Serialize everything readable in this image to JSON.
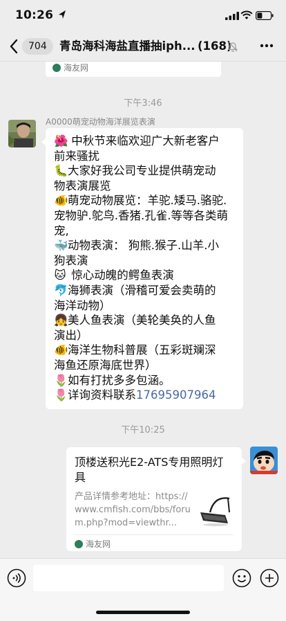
{
  "status": {
    "time": "10:26"
  },
  "header": {
    "badge": "704",
    "title": "青岛海科海盐直播抽iph...",
    "member_count": "(168)"
  },
  "chat": {
    "top_card_source": "海友网",
    "timestamp_1": "下午3:46",
    "sender_name": "A0000萌宠动物海洋展览表演",
    "message_lines": [
      {
        "emoji": "🌺",
        "text": " 中秋节来临欢迎广大新老客户"
      },
      {
        "emoji": "",
        "text": "前来骚扰"
      },
      {
        "emoji": "🐛",
        "text": "大家好我公司专业提供萌宠动"
      },
      {
        "emoji": "",
        "text": "物表演展览"
      },
      {
        "emoji": "🐠",
        "text": "萌宠动物展览：羊驼.矮马.骆驼."
      },
      {
        "emoji": "",
        "text": "宠物驴.鸵鸟.香猪.孔雀.等等各类萌"
      },
      {
        "emoji": "",
        "text": "宠,"
      },
      {
        "emoji": "🐳",
        "text": "动物表演：  狗熊.猴子.山羊.小"
      },
      {
        "emoji": "",
        "text": "狗表演"
      },
      {
        "emoji": "🐱",
        "text": " 惊心动魄的鳄鱼表演"
      },
      {
        "emoji": "🐬",
        "text": "海狮表演（滑稽可爱会卖萌的"
      },
      {
        "emoji": "",
        "text": "海洋动物）"
      },
      {
        "emoji": "👧",
        "text": "美人鱼表演（美轮美奂的人鱼"
      },
      {
        "emoji": "",
        "text": "演出）"
      },
      {
        "emoji": "🐠",
        "text": "海洋生物科普展（五彩斑斓深"
      },
      {
        "emoji": "",
        "text": "海鱼还原海底世界）"
      },
      {
        "emoji": "🌷",
        "text": "如有打扰多多包涵。"
      },
      {
        "emoji": "🌷",
        "text": "详询资料联系"
      }
    ],
    "phone": "17695907964",
    "timestamp_2": "下午10:25",
    "link_card": {
      "title": "顶楼送积光E2-ATS专用照明灯具",
      "description": "产品详情参考地址：https://www.cmfish.com/bbs/forum.php?mod=viewthr...",
      "source": "海友网"
    }
  },
  "colors": {
    "background": "#ededed",
    "bubble": "#ffffff",
    "link_blue": "#4a69a3"
  },
  "icons": [
    "location-arrow-icon",
    "signal-icon",
    "wifi-icon",
    "battery-icon",
    "back-chevron-icon",
    "mute-bell-icon",
    "more-dots-icon",
    "voice-icon",
    "emoji-icon",
    "plus-icon"
  ]
}
